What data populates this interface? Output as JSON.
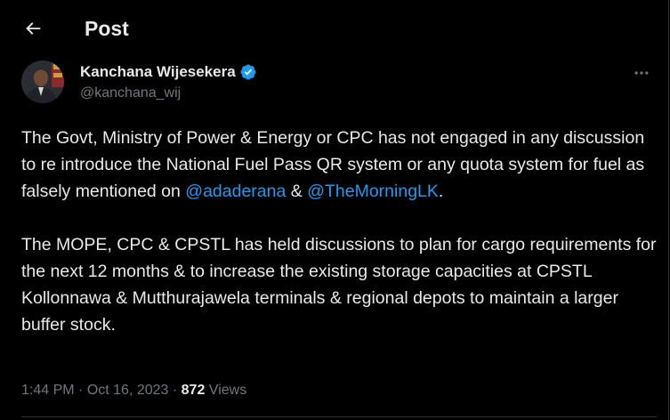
{
  "header": {
    "title": "Post",
    "back_icon": "arrow-left-icon"
  },
  "author": {
    "name": "Kanchana Wijesekera",
    "handle": "@kanchana_wij",
    "verified_icon": "verified-badge-icon",
    "more_icon": "more-horizontal-icon"
  },
  "tweet": {
    "para1_text_a": "The Govt, Ministry of Power & Energy or CPC has not engaged in any discussion to re introduce the National Fuel Pass QR system or any quota system for fuel as falsely mentioned on ",
    "mention1": "@adaderana",
    "para1_text_b": " & ",
    "mention2": "@TheMorningLK",
    "para1_text_c": ".",
    "para2_text": "The MOPE, CPC & CPSTL has held  discussions to plan for cargo requirements for the next 12 months & to increase the existing storage capacities at CPSTL Kollonnawa & Mutthurajawela terminals & regional depots to maintain a larger buffer stock."
  },
  "meta": {
    "time": "1:44 PM",
    "separator": " · ",
    "date": "Oct 16, 2023",
    "separator2": " · ",
    "views_count": "872",
    "views_label": " Views"
  },
  "colors": {
    "background": "#000000",
    "text_primary": "#e7e9ea",
    "text_secondary": "#71767b",
    "accent": "#1d9bf0",
    "divider": "#2f3336"
  }
}
